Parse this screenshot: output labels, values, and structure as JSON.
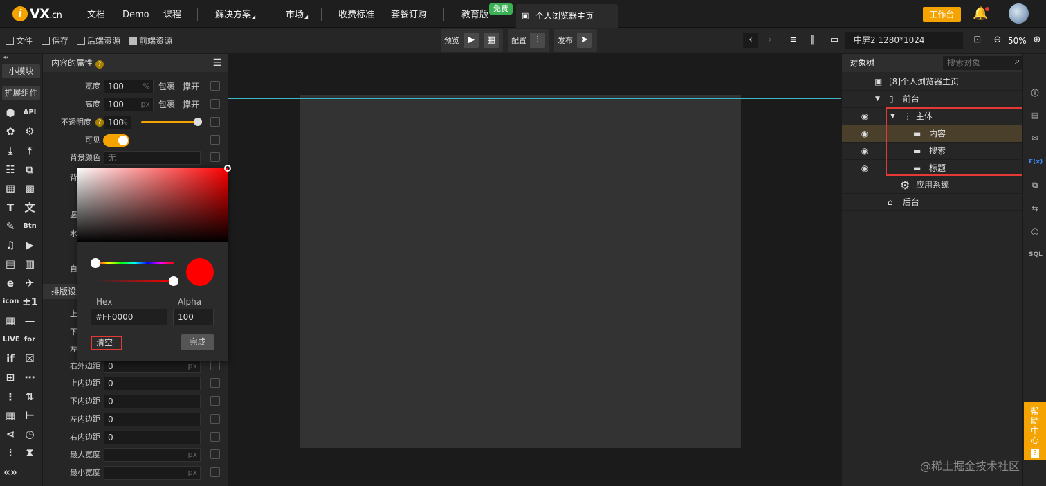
{
  "topbar": {
    "logo_text": "VX",
    "logo_suffix": ".cn",
    "nav": [
      "文档",
      "Demo",
      "课程",
      "解决方案",
      "市场",
      "收费标准",
      "套餐订购",
      "教育版"
    ],
    "free_badge": "免费",
    "active_tab": "个人浏览器主页",
    "workbench": "工作台"
  },
  "toolbar": {
    "file": "文件",
    "save": "保存",
    "backend_res": "后端资源",
    "frontend_res": "前端资源",
    "preview": "预览",
    "config": "配置",
    "publish": "发布",
    "screen": "中屏2 1280*1024",
    "zoom": "50%"
  },
  "leftbar": {
    "tab_small": "小模块",
    "tab_ext": "扩展组件",
    "icons": [
      "cube-icon",
      "API",
      "flower-icon",
      "gear-icon",
      "download-icon",
      "upload-icon",
      "list-icon",
      "copy-icon",
      "image-icon",
      "image2-icon",
      "T",
      "translate-icon",
      "edit-icon",
      "Btn",
      "music-icon",
      "video-icon",
      "form-icon",
      "form2-icon",
      "e",
      "map-icon",
      "icon",
      "±1",
      "qr-icon",
      "—",
      "LIVE",
      "for",
      "if",
      "close-box-icon",
      "grid-icon",
      "dots-icon",
      "vert-dots-icon",
      "sort-icon",
      "table-icon",
      "tree-icon",
      "share-icon",
      "clock-icon",
      "slider-icon",
      "hourglass-icon",
      "code-icon"
    ]
  },
  "props": {
    "title": "内容的属性",
    "width_label": "宽度",
    "width_value": "100",
    "width_unit": "%",
    "height_label": "高度",
    "height_value": "100",
    "height_unit": "px",
    "wrap": "包裹",
    "expand": "撑开",
    "opacity_label": "不透明度",
    "opacity_value": "100",
    "opacity_unit": "%",
    "visible_label": "可见",
    "bgcolor_label": "背景颜色",
    "bgcolor_value": "无",
    "partial_labels": [
      "背",
      "竖",
      "水",
      "自"
    ],
    "section2": "排版设置",
    "layout_partial": [
      "上",
      "下",
      "左"
    ],
    "rows": [
      {
        "label": "右外边距",
        "value": "0",
        "unit": "px"
      },
      {
        "label": "上内边距",
        "value": "0",
        "unit": ""
      },
      {
        "label": "下内边距",
        "value": "0",
        "unit": ""
      },
      {
        "label": "左内边距",
        "value": "0",
        "unit": ""
      },
      {
        "label": "右内边距",
        "value": "0",
        "unit": ""
      },
      {
        "label": "最大宽度",
        "value": "",
        "unit": "px"
      },
      {
        "label": "最小宽度",
        "value": "",
        "unit": "px"
      }
    ]
  },
  "picker": {
    "hex_label": "Hex",
    "hex_value": "#FF0000",
    "alpha_label": "Alpha",
    "alpha_value": "100",
    "clear": "清空",
    "done": "完成",
    "color": "#FF0000"
  },
  "tree": {
    "title": "对象树",
    "search_placeholder": "搜索对象",
    "items": [
      {
        "label": "[8]个人浏览器主页"
      },
      {
        "label": "前台"
      },
      {
        "label": "主体"
      },
      {
        "label": "内容"
      },
      {
        "label": "搜索"
      },
      {
        "label": "标题"
      },
      {
        "label": "应用系统"
      },
      {
        "label": "后台"
      }
    ]
  },
  "rightbar": {
    "icons": [
      "info-icon",
      "chart-icon",
      "chat-icon",
      "F(x)",
      "copy-icon",
      "swap-icon",
      "face-icon",
      "SQL"
    ]
  },
  "help": "帮助中心",
  "watermark": "@稀土掘金技术社区"
}
